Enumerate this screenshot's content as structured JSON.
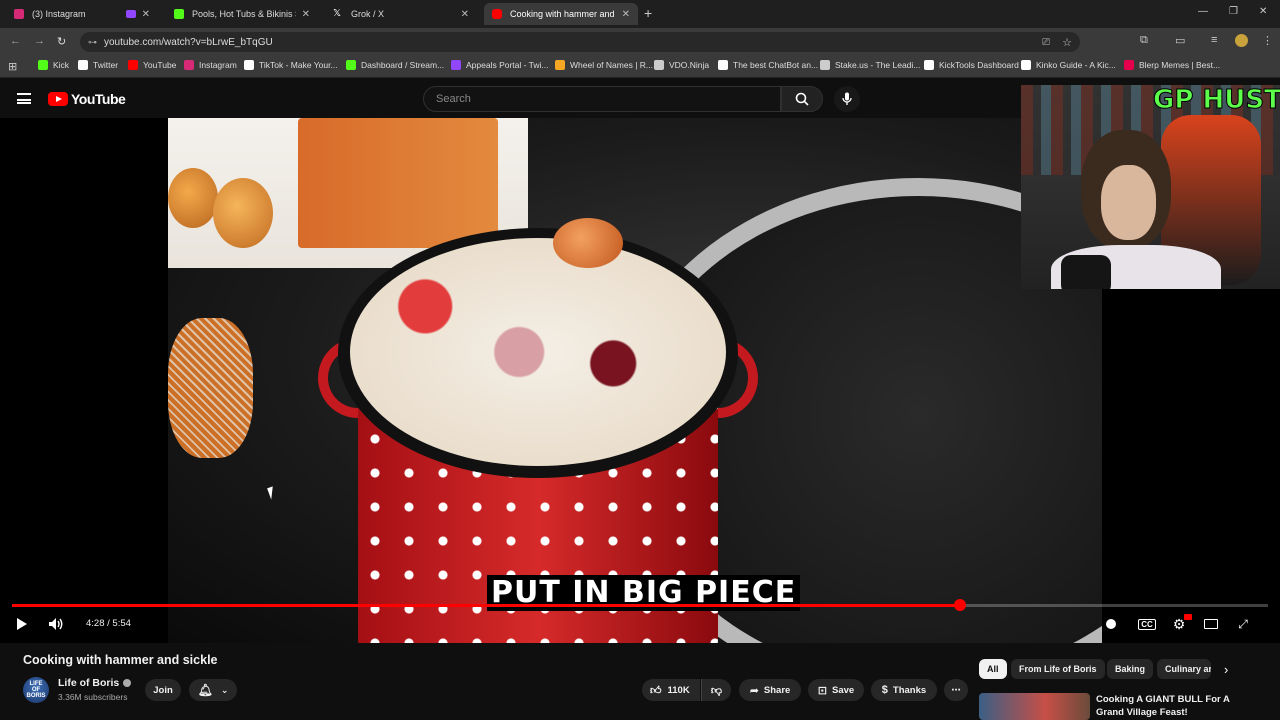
{
  "browser": {
    "tabs": [
      {
        "title": "(3) Instagram",
        "color": "#d62976"
      },
      {
        "title": "Pools, Hot Tubs & Bikinis Strea",
        "color": "#53fc18"
      },
      {
        "title": "Grok / X",
        "color": "#ffffff"
      },
      {
        "title": "Cooking with hammer and sickl",
        "color": "#ff0000"
      }
    ],
    "url": "youtube.com/watch?v=bLrwE_bTqGU",
    "bookmarks": [
      {
        "label": "Kick",
        "color": "#53fc18"
      },
      {
        "label": "Twitter",
        "color": "#ffffff"
      },
      {
        "label": "YouTube",
        "color": "#ff0000"
      },
      {
        "label": "Instagram",
        "color": "#d62976"
      },
      {
        "label": "TikTok - Make Your...",
        "color": "#ffffff"
      },
      {
        "label": "Dashboard / Stream...",
        "color": "#53fc18"
      },
      {
        "label": "Appeals Portal - Twi...",
        "color": "#9146ff"
      },
      {
        "label": "Wheel of Names | R...",
        "color": "#f5a623"
      },
      {
        "label": "VDO.Ninja",
        "color": "#cccccc"
      },
      {
        "label": "The best ChatBot an...",
        "color": "#ffffff"
      },
      {
        "label": "Stake.us - The Leadi...",
        "color": "#cccccc"
      },
      {
        "label": "KickTools Dashboard",
        "color": "#ffffff"
      },
      {
        "label": "Kinko Guide - A Kic...",
        "color": "#ffffff"
      },
      {
        "label": "Blerp Memes | Best...",
        "color": "#e4004b"
      }
    ]
  },
  "youtube": {
    "logo_text": "YouTube",
    "search_placeholder": "Search",
    "video": {
      "subtitle": "PUT IN BIG PIECE",
      "time_current": "4:28",
      "time_total": "5:54",
      "time_display": "4:28 / 5:54",
      "progress": 0.755
    },
    "overlay_tag": "GP HUSTLA",
    "title": "Cooking with hammer and sickle",
    "channel": {
      "name": "Life of Boris",
      "subscribers": "3.36M subscribers",
      "avatar_text": "LIFE OF BORIS"
    },
    "actions": {
      "join": "Join",
      "likes": "110K",
      "share": "Share",
      "save": "Save",
      "thanks": "Thanks"
    },
    "chips": [
      "All",
      "From Life of Boris",
      "Baking",
      "Culinary ar"
    ],
    "recommendation": {
      "title": "Cooking A GIANT BULL For A Grand Village Feast!"
    },
    "accent": "#ff0000"
  }
}
